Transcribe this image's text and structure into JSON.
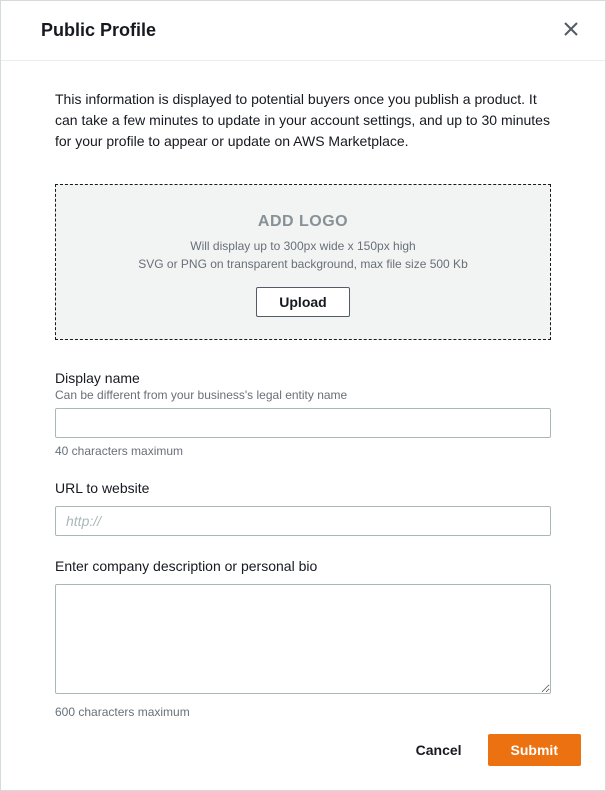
{
  "header": {
    "title": "Public Profile"
  },
  "intro": "This information is displayed to potential buyers once you publish a product. It can take a few minutes to update in your account settings, and up to 30 minutes for your profile to appear or update on AWS Marketplace.",
  "logo": {
    "title": "ADD LOGO",
    "hint_line1": "Will display up to 300px wide x 150px high",
    "hint_line2": "SVG or PNG on transparent background, max file size 500 Kb",
    "upload_label": "Upload"
  },
  "fields": {
    "display_name": {
      "label": "Display name",
      "hint": "Can be different from your business's legal entity name",
      "value": "",
      "limit": "40 characters maximum"
    },
    "url": {
      "label": "URL to website",
      "placeholder": "http://",
      "value": ""
    },
    "description": {
      "label": "Enter company description or personal bio",
      "value": "",
      "limit": "600 characters maximum"
    }
  },
  "footer": {
    "cancel_label": "Cancel",
    "submit_label": "Submit"
  }
}
